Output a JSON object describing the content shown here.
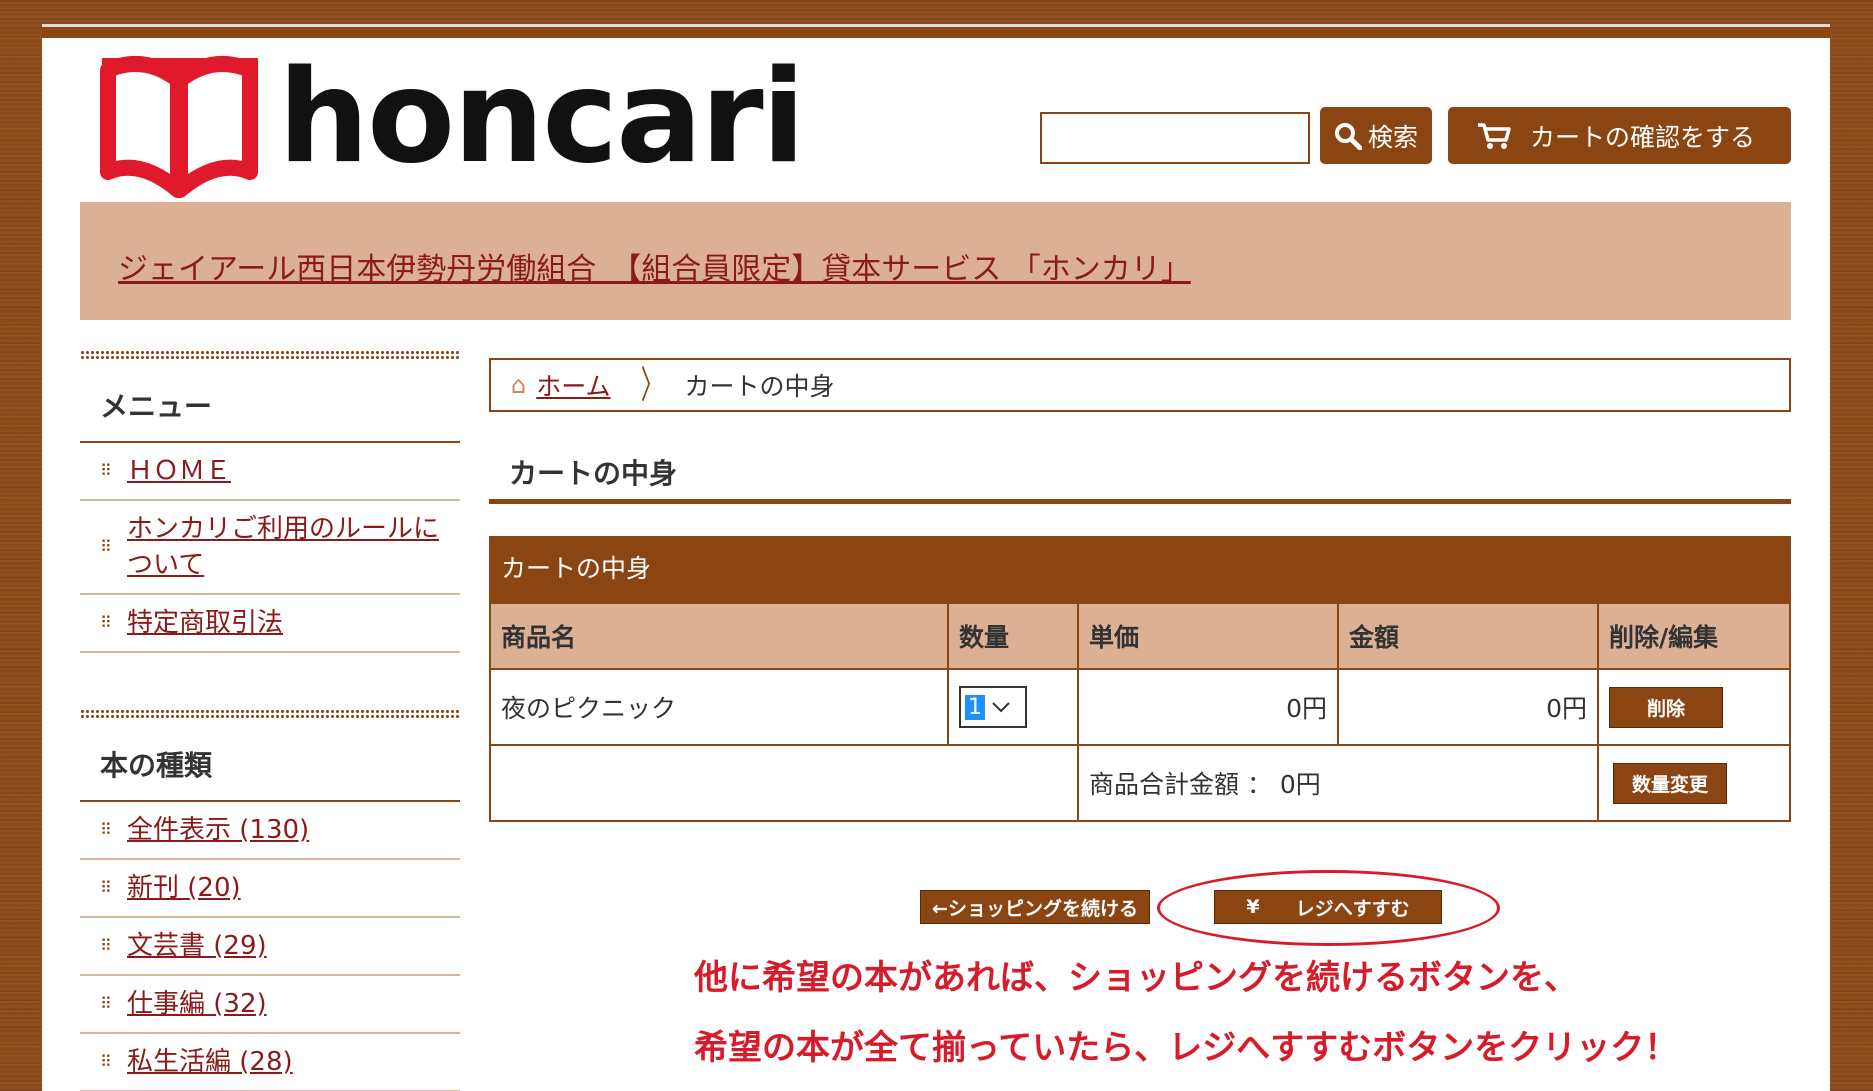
{
  "header": {
    "logo_text": "honcari",
    "search_button_label": "検索",
    "cart_button_label": "カートの確認をする",
    "search_value": ""
  },
  "banner": {
    "link_text": "ジェイアール西日本伊勢丹労働組合　【組合員限定】貸本サービス 「ホンカリ」"
  },
  "sidebar": {
    "menu_heading": "メニュー",
    "menu_items": [
      {
        "label": "ＨＯＭＥ"
      },
      {
        "label": "ホンカリご利用のルールについて"
      },
      {
        "label": "特定商取引法"
      }
    ],
    "category_heading": "本の種類",
    "category_items": [
      {
        "label": "全件表示 (130)"
      },
      {
        "label": "新刊 (20)"
      },
      {
        "label": "文芸書 (29)"
      },
      {
        "label": "仕事編 (32)"
      },
      {
        "label": "私生活編 (28)"
      }
    ]
  },
  "breadcrumb": {
    "home": "ホーム",
    "current": "カートの中身"
  },
  "main": {
    "title": "カートの中身",
    "table": {
      "caption": "カートの中身",
      "headers": [
        "商品名",
        "数量",
        "単価",
        "金額",
        "削除/編集"
      ],
      "rows": [
        {
          "name": "夜のピクニック",
          "quantity": "1",
          "unit_price": "0円",
          "amount": "0円",
          "action": "削除"
        }
      ],
      "total_label": "商品合計金額 ： 0円",
      "update_button": "数量変更"
    },
    "continue_button": "←ショッピングを続ける",
    "register_icon": "¥",
    "register_button": "レジへすすむ"
  },
  "annotation": {
    "line1": "他に希望の本があれば、ショッピングを続けるボタンを、",
    "line2": "希望の本が全て揃っていたら、レジへすすむボタンをクリック！",
    "color": "#d81b2a"
  },
  "colors": {
    "brand": "#8b4513",
    "banner_bg": "#dbb094",
    "link": "#8b1a1a",
    "logo_red": "#e0192d"
  }
}
